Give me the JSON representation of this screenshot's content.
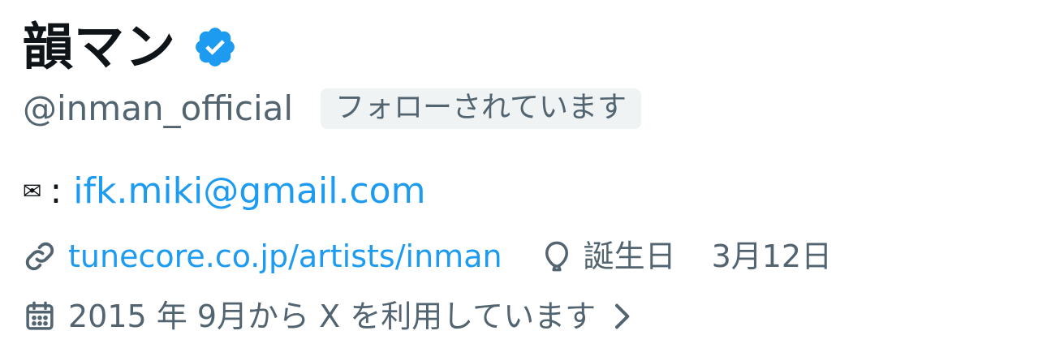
{
  "profile": {
    "display_name": "韻マン",
    "verified_icon": "verified-badge-icon",
    "handle": "@inman_official",
    "follows_you_label": "フォローされています",
    "bio": {
      "envelope_glyph": "✉",
      "colon": ":",
      "email": "ifk.miki@gmail.com"
    },
    "url": "tunecore.co.jp/artists/inman",
    "birthday_label": "誕生日",
    "birthday_date": "3月12日",
    "joined_text": "2015 年 9月から X を利用しています"
  },
  "colors": {
    "accent": "#1d9bf0",
    "secondary_text": "#536471",
    "primary_text": "#0f1419",
    "badge_bg": "#eff3f4"
  }
}
